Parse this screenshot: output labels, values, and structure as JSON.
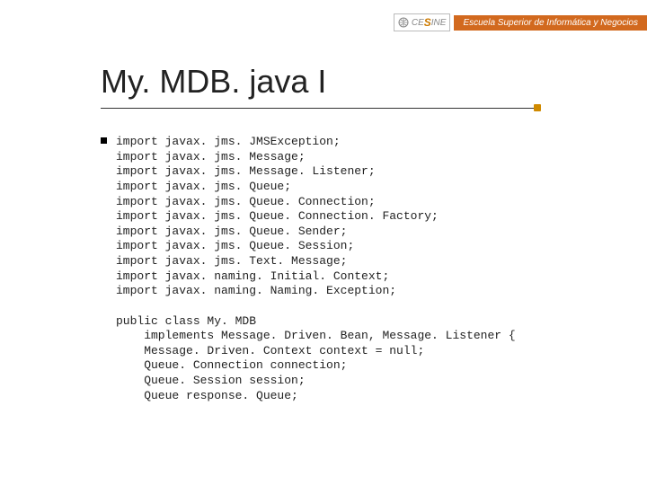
{
  "brand": {
    "logo_prefix": "CE",
    "logo_accent": "S",
    "logo_suffix": "INE",
    "tagline": "Escuela Superior de Informática y Negocios"
  },
  "title": "My. MDB. java I",
  "code": {
    "imports": [
      "import javax. jms. JMSException;",
      "import javax. jms. Message;",
      "import javax. jms. Message. Listener;",
      "import javax. jms. Queue;",
      "import javax. jms. Queue. Connection;",
      "import javax. jms. Queue. Connection. Factory;",
      "import javax. jms. Queue. Sender;",
      "import javax. jms. Queue. Session;",
      "import javax. jms. Text. Message;",
      "import javax. naming. Initial. Context;",
      "import javax. naming. Naming. Exception;"
    ],
    "class_decl": "public class My. MDB",
    "implements": "    implements Message. Driven. Bean, Message. Listener {",
    "body": [
      "    Message. Driven. Context context = null;",
      "    Queue. Connection connection;",
      "    Queue. Session session;",
      "    Queue response. Queue;"
    ]
  }
}
